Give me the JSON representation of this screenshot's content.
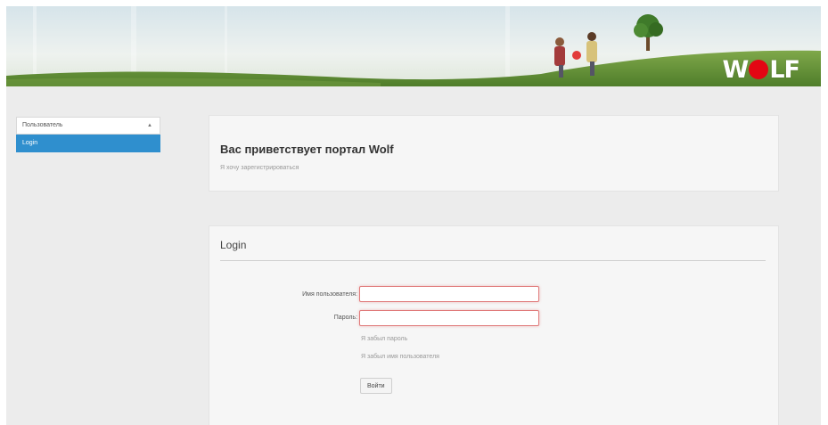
{
  "brand": {
    "logo_left": "W",
    "logo_right": "LF"
  },
  "sidebar": {
    "items": [
      {
        "label": "Пользователь",
        "caret": "▲"
      },
      {
        "label": "Login"
      }
    ]
  },
  "welcome": {
    "title": "Вас приветствует портал Wolf",
    "subtitle": "Я хочу зарегистрироваться"
  },
  "login": {
    "heading": "Login",
    "username_label": "Имя пользователя:",
    "username_value": "",
    "password_label": "Пароль:",
    "password_value": "",
    "forgot_password": "Я забыл пароль",
    "forgot_username": "Я забыл имя пользователя",
    "submit_label": "Войти"
  },
  "colors": {
    "accent": "#2f8fce",
    "logo_red": "#e30613",
    "input_border_error": "#e07a7a",
    "background": "#ececec"
  }
}
